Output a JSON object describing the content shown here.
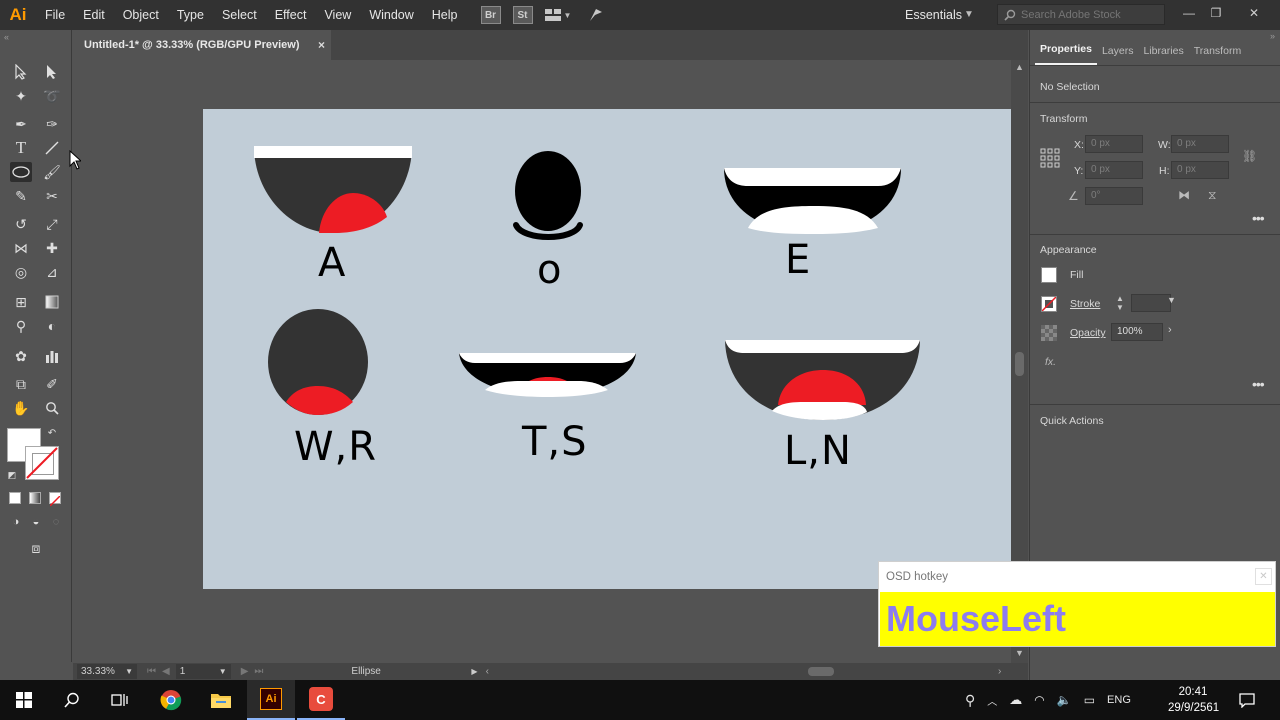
{
  "app": {
    "logo": "Ai",
    "menu": [
      "File",
      "Edit",
      "Object",
      "Type",
      "Select",
      "Effect",
      "View",
      "Window",
      "Help"
    ],
    "bridge_badge": "Br",
    "stock_badge": "St",
    "workspace": "Essentials",
    "search_placeholder": "Search Adobe Stock"
  },
  "document": {
    "tab_title": "Untitled-1* @ 33.33% (RGB/GPU Preview)",
    "close": "×"
  },
  "artboard": {
    "background": "#c1cdd7",
    "mouth_labels": [
      "A",
      "o",
      "E",
      "W,R",
      "T,S",
      "L,N"
    ],
    "colors": {
      "dark": "#333333",
      "black": "#000000",
      "white": "#ffffff",
      "red": "#ed1c24"
    }
  },
  "statusbar": {
    "zoom": "33.33%",
    "artboard_number": "1",
    "current_tool": "Ellipse"
  },
  "properties": {
    "tabs": [
      "Properties",
      "Layers",
      "Libraries",
      "Transform"
    ],
    "selection": "No Selection",
    "transform_heading": "Transform",
    "x_label": "X:",
    "x_value": "0 px",
    "y_label": "Y:",
    "y_value": "0 px",
    "w_label": "W:",
    "w_value": "0 px",
    "h_label": "H:",
    "h_value": "0 px",
    "angle_value": "0°",
    "appearance_heading": "Appearance",
    "fill_label": "Fill",
    "stroke_label": "Stroke",
    "opacity_label": "Opacity",
    "opacity_value": "100%",
    "fx_label": "fx.",
    "quick_actions": "Quick Actions"
  },
  "osd": {
    "title": "OSD hotkey",
    "key": "MouseLeft",
    "key_color": "#8c7cf0",
    "bg_color": "#ffff00"
  },
  "taskbar": {
    "language": "ENG",
    "time": "20:41",
    "date": "29/9/2561"
  }
}
